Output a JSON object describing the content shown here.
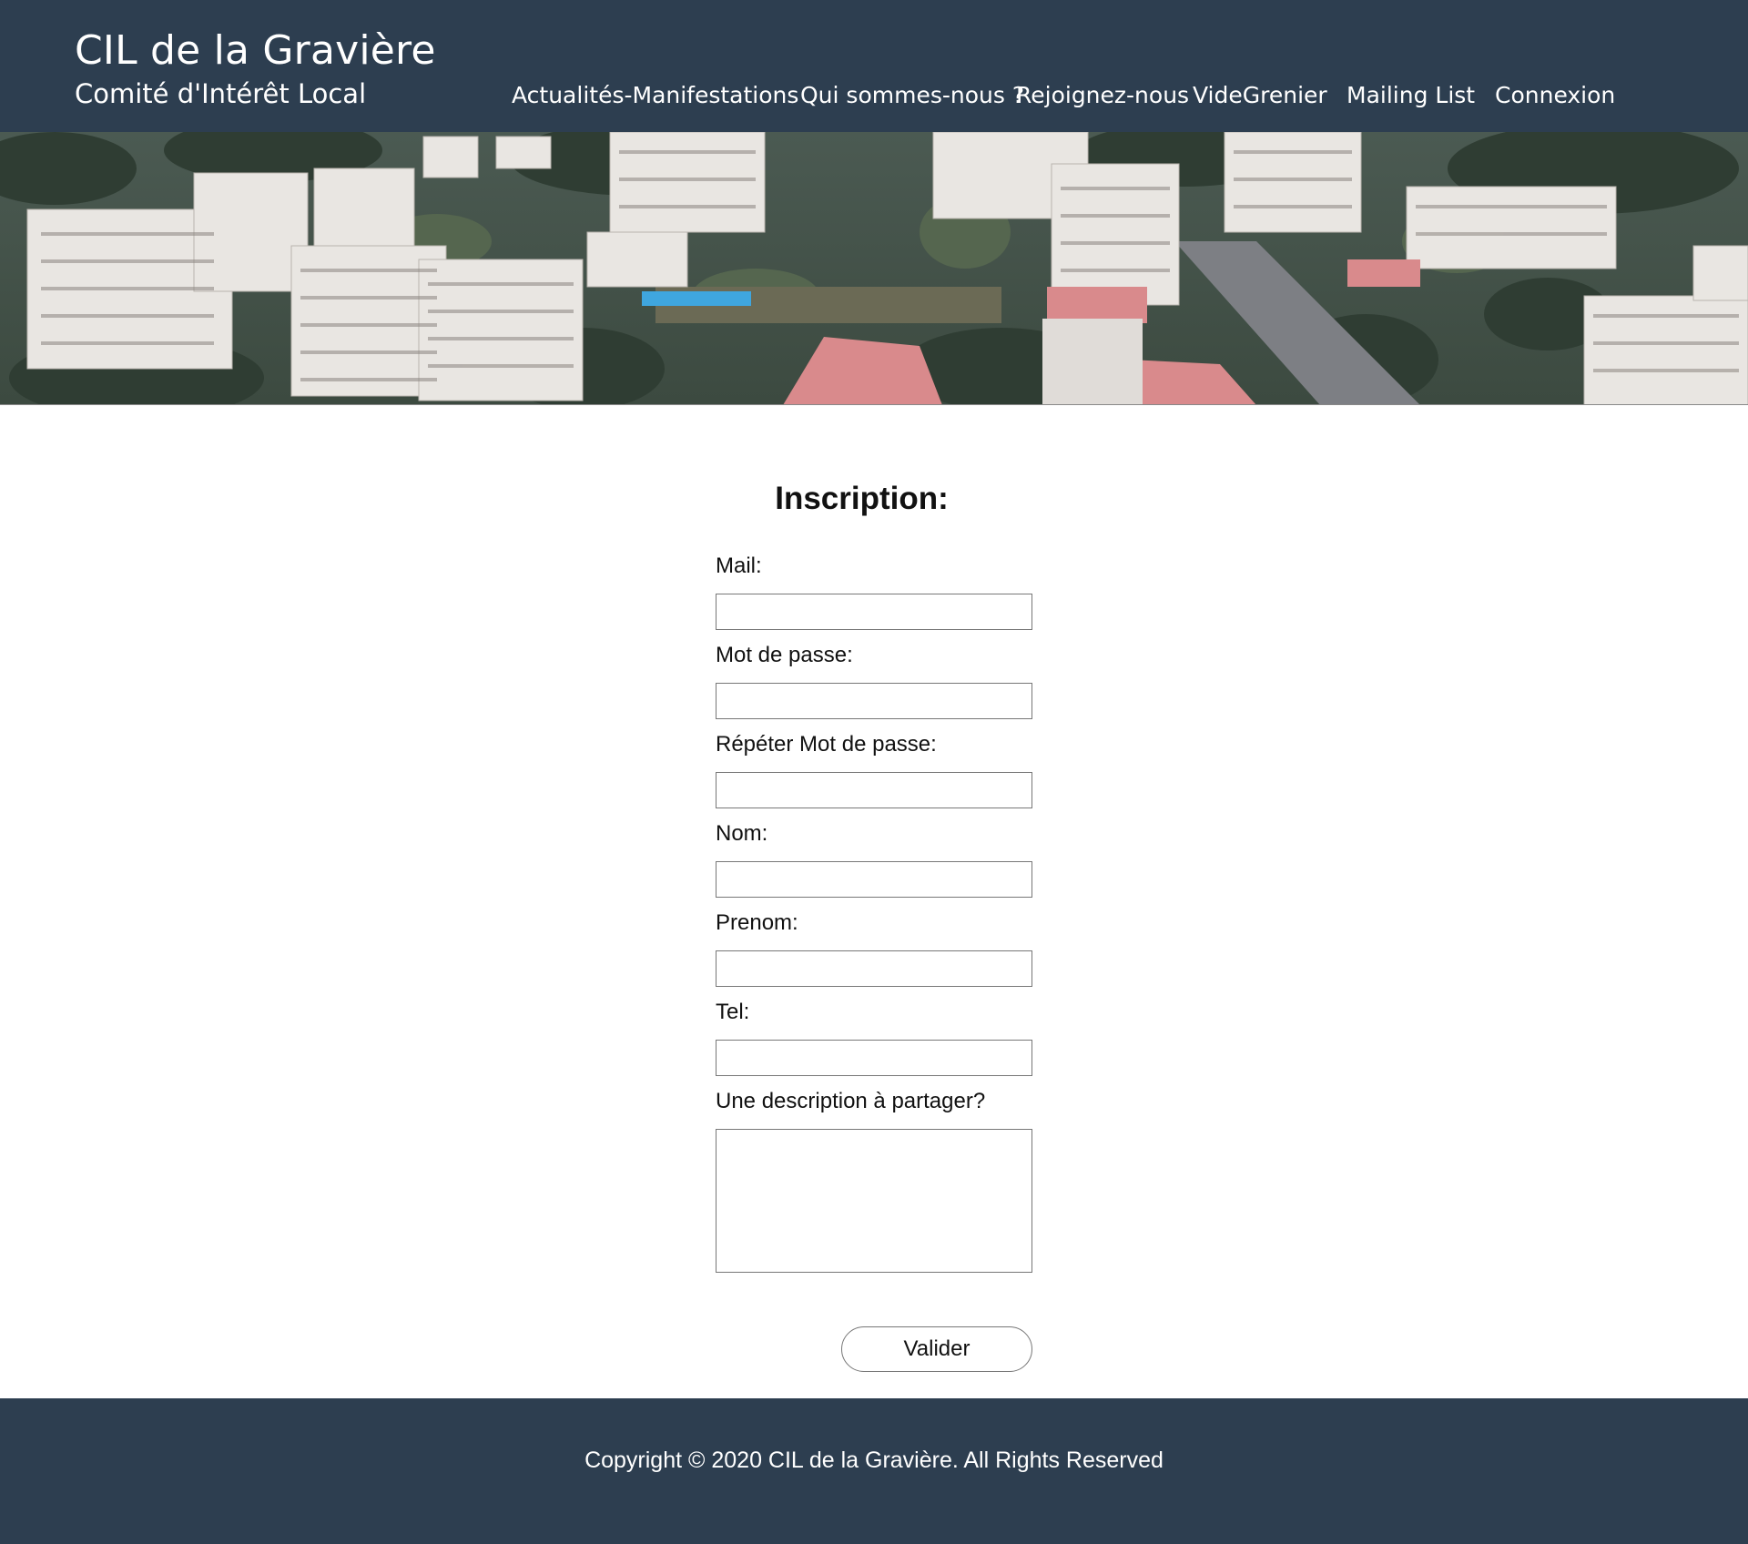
{
  "header": {
    "title": "CIL de la Gravière",
    "subtitle": "Comité d'Intérêt Local",
    "nav": [
      {
        "label": "Actualités-Manifestations"
      },
      {
        "label": "Qui sommes-nous ?"
      },
      {
        "label": "Rejoignez-nous"
      },
      {
        "label": "VideGrenier"
      },
      {
        "label": "Mailing List"
      },
      {
        "label": "Connexion"
      }
    ]
  },
  "banner": {
    "icon": "aerial-city-photo"
  },
  "form": {
    "title": "Inscription:",
    "fields": [
      {
        "label": "Mail:",
        "value": ""
      },
      {
        "label": "Mot de passe:",
        "value": ""
      },
      {
        "label": "Répéter Mot de passe:",
        "value": ""
      },
      {
        "label": "Nom:",
        "value": ""
      },
      {
        "label": "Prenom:",
        "value": ""
      },
      {
        "label": "Tel:",
        "value": ""
      }
    ],
    "description_label": "Une description à partager?",
    "description_value": "",
    "submit_label": "Valider"
  },
  "footer": {
    "copyright": "Copyright © 2020 CIL de la Gravière. All Rights Reserved"
  },
  "colors": {
    "header_bg": "#2d3e50",
    "footer_bg": "#2d3e50",
    "text_light": "#ffffff"
  }
}
